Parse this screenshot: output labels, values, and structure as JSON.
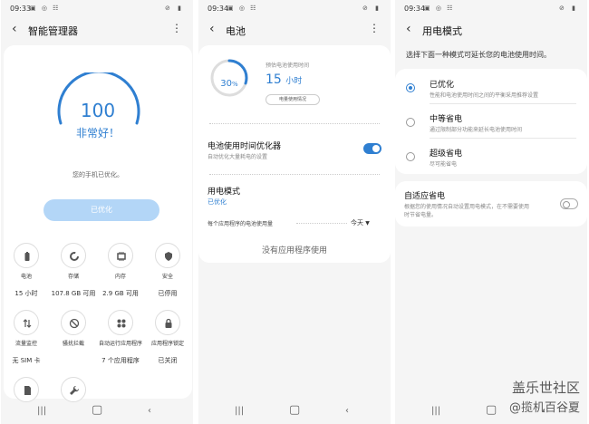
{
  "panel1": {
    "status": {
      "time": "09:33"
    },
    "title": "智能管理器",
    "score": "100",
    "score_status": "非常好！",
    "message": "您的手机已优化。",
    "optimize_button": "已优化",
    "items": [
      {
        "label": "电池",
        "value": "15 小时",
        "icon": "battery-icon"
      },
      {
        "label": "存储",
        "value": "107.8 GB 可用",
        "icon": "storage-icon"
      },
      {
        "label": "内存",
        "value": "2.9 GB 可用",
        "icon": "memory-icon"
      },
      {
        "label": "安全",
        "value": "已停用",
        "icon": "shield-icon"
      },
      {
        "label": "流量监控",
        "value": "无 SIM 卡",
        "icon": "data-monitor-icon"
      },
      {
        "label": "骚扰拦截",
        "value": "",
        "icon": "block-icon"
      },
      {
        "label": "自动运行应用程序",
        "value": "7 个应用程序",
        "icon": "auto-run-icon"
      },
      {
        "label": "应用程序锁定",
        "value": "已关闭",
        "icon": "lock-icon"
      }
    ]
  },
  "panel2": {
    "status": {
      "time": "09:34"
    },
    "title": "电池",
    "percent": "30",
    "percent_suffix": "%",
    "battery_level": 0.3,
    "estimate_label": "预估电池使用时间",
    "estimate_value": "15",
    "estimate_unit": "小时",
    "usage_button": "电量使用情况",
    "optimizer_title": "电池使用时间优化器",
    "optimizer_sub": "自动优化大量耗电的设置",
    "optimizer_on": true,
    "power_mode_title": "用电模式",
    "power_mode_value": "已优化",
    "per_app_label": "每个应用程序的电池使用量",
    "period": "今天",
    "no_apps": "没有应用程序使用"
  },
  "panel3": {
    "status": {
      "time": "09:34"
    },
    "title": "用电模式",
    "intro": "选择下面一种模式可延长您的电池使用时间。",
    "modes": [
      {
        "title": "已优化",
        "sub": "性能和电池使用时间之间的平衡采用推荐设置",
        "selected": true
      },
      {
        "title": "中等省电",
        "sub": "通过限制部分功能来延长电池使用时间",
        "selected": false
      },
      {
        "title": "超级省电",
        "sub": "尽可能省电",
        "selected": false
      }
    ],
    "adaptive_title": "自适应省电",
    "adaptive_sub_1": "根据您的使用情况自动设置用电模式，在不需要使用",
    "adaptive_sub_2": "时节省电量。",
    "adaptive_on": false
  },
  "watermark": {
    "line1": "盖乐世社区",
    "line2": "@揽机百谷夏"
  },
  "colors": {
    "accent": "#2f7fd1",
    "button_disabled": "#b3d6f7",
    "background": "#f5f5f5"
  }
}
